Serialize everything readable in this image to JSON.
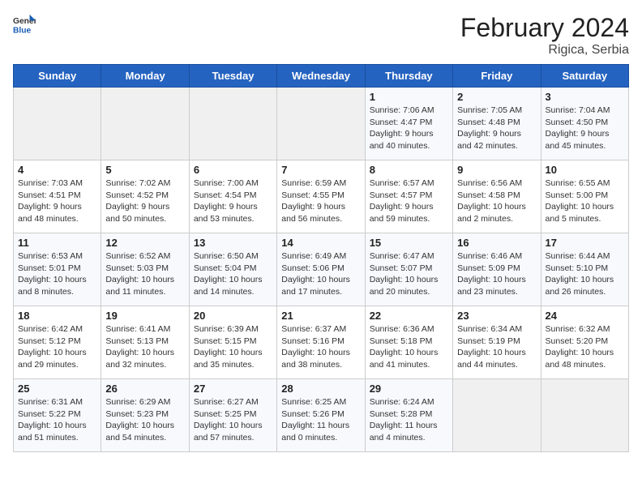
{
  "header": {
    "logo_general": "General",
    "logo_blue": "Blue",
    "month_year": "February 2024",
    "location": "Rigica, Serbia"
  },
  "columns": [
    "Sunday",
    "Monday",
    "Tuesday",
    "Wednesday",
    "Thursday",
    "Friday",
    "Saturday"
  ],
  "weeks": [
    [
      {
        "day": "",
        "info": ""
      },
      {
        "day": "",
        "info": ""
      },
      {
        "day": "",
        "info": ""
      },
      {
        "day": "",
        "info": ""
      },
      {
        "day": "1",
        "info": "Sunrise: 7:06 AM\nSunset: 4:47 PM\nDaylight: 9 hours\nand 40 minutes."
      },
      {
        "day": "2",
        "info": "Sunrise: 7:05 AM\nSunset: 4:48 PM\nDaylight: 9 hours\nand 42 minutes."
      },
      {
        "day": "3",
        "info": "Sunrise: 7:04 AM\nSunset: 4:50 PM\nDaylight: 9 hours\nand 45 minutes."
      }
    ],
    [
      {
        "day": "4",
        "info": "Sunrise: 7:03 AM\nSunset: 4:51 PM\nDaylight: 9 hours\nand 48 minutes."
      },
      {
        "day": "5",
        "info": "Sunrise: 7:02 AM\nSunset: 4:52 PM\nDaylight: 9 hours\nand 50 minutes."
      },
      {
        "day": "6",
        "info": "Sunrise: 7:00 AM\nSunset: 4:54 PM\nDaylight: 9 hours\nand 53 minutes."
      },
      {
        "day": "7",
        "info": "Sunrise: 6:59 AM\nSunset: 4:55 PM\nDaylight: 9 hours\nand 56 minutes."
      },
      {
        "day": "8",
        "info": "Sunrise: 6:57 AM\nSunset: 4:57 PM\nDaylight: 9 hours\nand 59 minutes."
      },
      {
        "day": "9",
        "info": "Sunrise: 6:56 AM\nSunset: 4:58 PM\nDaylight: 10 hours\nand 2 minutes."
      },
      {
        "day": "10",
        "info": "Sunrise: 6:55 AM\nSunset: 5:00 PM\nDaylight: 10 hours\nand 5 minutes."
      }
    ],
    [
      {
        "day": "11",
        "info": "Sunrise: 6:53 AM\nSunset: 5:01 PM\nDaylight: 10 hours\nand 8 minutes."
      },
      {
        "day": "12",
        "info": "Sunrise: 6:52 AM\nSunset: 5:03 PM\nDaylight: 10 hours\nand 11 minutes."
      },
      {
        "day": "13",
        "info": "Sunrise: 6:50 AM\nSunset: 5:04 PM\nDaylight: 10 hours\nand 14 minutes."
      },
      {
        "day": "14",
        "info": "Sunrise: 6:49 AM\nSunset: 5:06 PM\nDaylight: 10 hours\nand 17 minutes."
      },
      {
        "day": "15",
        "info": "Sunrise: 6:47 AM\nSunset: 5:07 PM\nDaylight: 10 hours\nand 20 minutes."
      },
      {
        "day": "16",
        "info": "Sunrise: 6:46 AM\nSunset: 5:09 PM\nDaylight: 10 hours\nand 23 minutes."
      },
      {
        "day": "17",
        "info": "Sunrise: 6:44 AM\nSunset: 5:10 PM\nDaylight: 10 hours\nand 26 minutes."
      }
    ],
    [
      {
        "day": "18",
        "info": "Sunrise: 6:42 AM\nSunset: 5:12 PM\nDaylight: 10 hours\nand 29 minutes."
      },
      {
        "day": "19",
        "info": "Sunrise: 6:41 AM\nSunset: 5:13 PM\nDaylight: 10 hours\nand 32 minutes."
      },
      {
        "day": "20",
        "info": "Sunrise: 6:39 AM\nSunset: 5:15 PM\nDaylight: 10 hours\nand 35 minutes."
      },
      {
        "day": "21",
        "info": "Sunrise: 6:37 AM\nSunset: 5:16 PM\nDaylight: 10 hours\nand 38 minutes."
      },
      {
        "day": "22",
        "info": "Sunrise: 6:36 AM\nSunset: 5:18 PM\nDaylight: 10 hours\nand 41 minutes."
      },
      {
        "day": "23",
        "info": "Sunrise: 6:34 AM\nSunset: 5:19 PM\nDaylight: 10 hours\nand 44 minutes."
      },
      {
        "day": "24",
        "info": "Sunrise: 6:32 AM\nSunset: 5:20 PM\nDaylight: 10 hours\nand 48 minutes."
      }
    ],
    [
      {
        "day": "25",
        "info": "Sunrise: 6:31 AM\nSunset: 5:22 PM\nDaylight: 10 hours\nand 51 minutes."
      },
      {
        "day": "26",
        "info": "Sunrise: 6:29 AM\nSunset: 5:23 PM\nDaylight: 10 hours\nand 54 minutes."
      },
      {
        "day": "27",
        "info": "Sunrise: 6:27 AM\nSunset: 5:25 PM\nDaylight: 10 hours\nand 57 minutes."
      },
      {
        "day": "28",
        "info": "Sunrise: 6:25 AM\nSunset: 5:26 PM\nDaylight: 11 hours\nand 0 minutes."
      },
      {
        "day": "29",
        "info": "Sunrise: 6:24 AM\nSunset: 5:28 PM\nDaylight: 11 hours\nand 4 minutes."
      },
      {
        "day": "",
        "info": ""
      },
      {
        "day": "",
        "info": ""
      }
    ]
  ]
}
